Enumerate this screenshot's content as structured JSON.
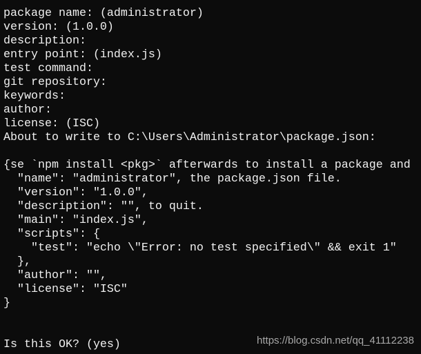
{
  "terminal": {
    "lines": [
      "package name: (administrator)",
      "version: (1.0.0)",
      "description:",
      "entry point: (index.js)",
      "test command:",
      "git repository:",
      "keywords:",
      "author:",
      "license: (ISC)",
      "About to write to C:\\Users\\Administrator\\package.json:",
      "",
      "{se `npm install <pkg>` afterwards to install a package and",
      "  \"name\": \"administrator\", the package.json file.",
      "  \"version\": \"1.0.0\",",
      "  \"description\": \"\", to quit.",
      "  \"main\": \"index.js\",",
      "  \"scripts\": {",
      "    \"test\": \"echo \\\"Error: no test specified\\\" && exit 1\"",
      "  },",
      "  \"author\": \"\",",
      "  \"license\": \"ISC\"",
      "}",
      "",
      "",
      "Is this OK? (yes)"
    ]
  },
  "watermark": "https://blog.csdn.net/qq_41112238",
  "colors": {
    "background": "#0c0c0c",
    "text": "#f0f0f0"
  }
}
